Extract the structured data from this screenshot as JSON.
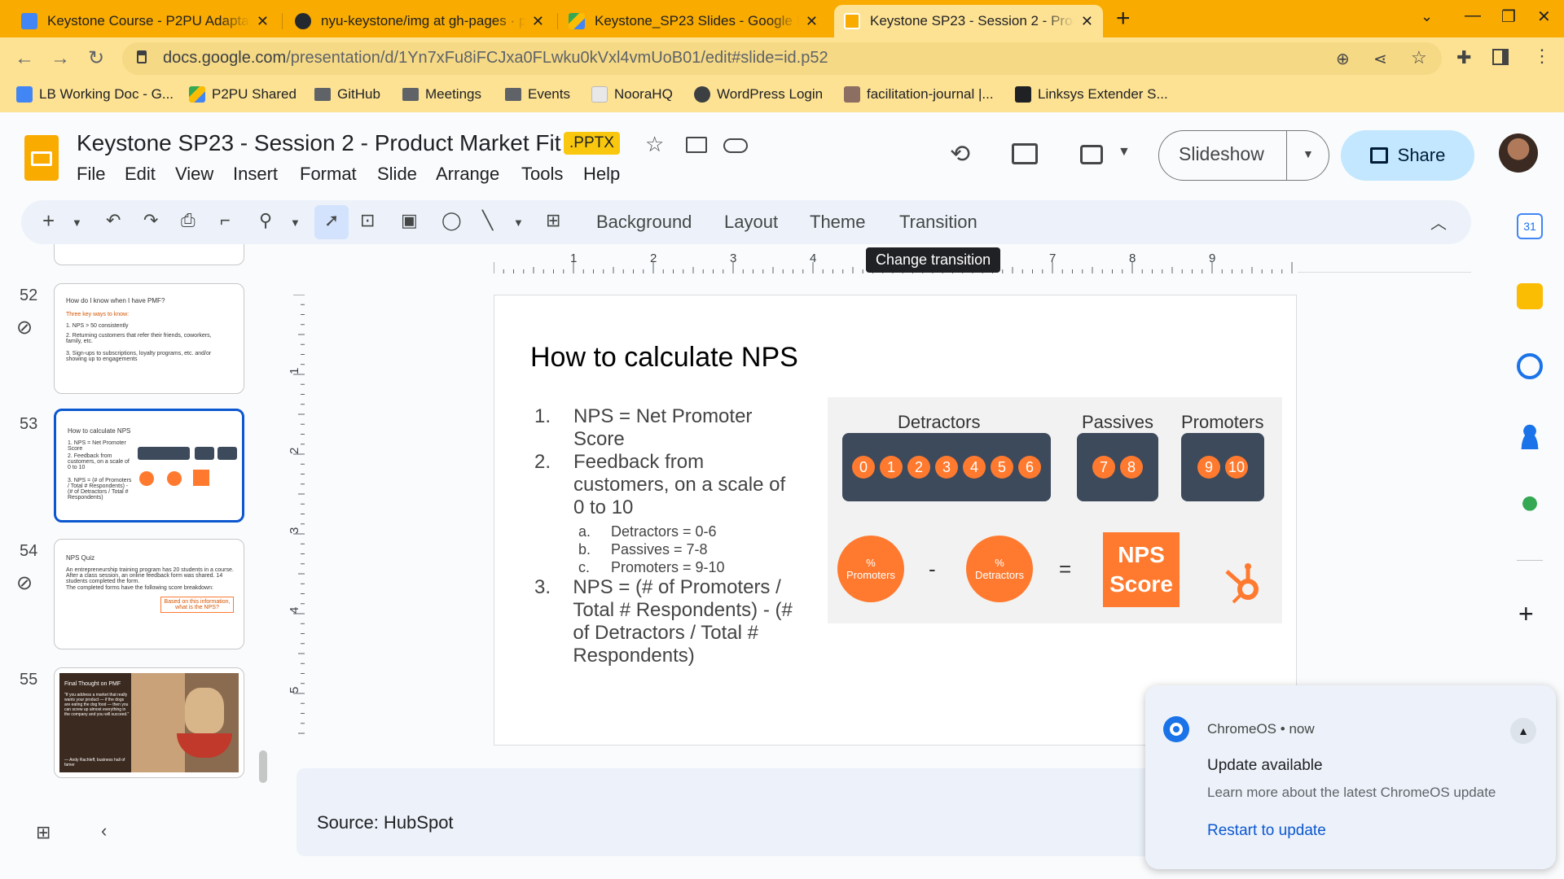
{
  "browser": {
    "tabs": [
      {
        "title": "Keystone Course - P2PU Adaptat",
        "color": "#4285f4"
      },
      {
        "title": "nyu-keystone/img at gh-pages · p",
        "color": "#24292f"
      },
      {
        "title": "Keystone_SP23 Slides - Google D",
        "color": "#34a853"
      },
      {
        "title": "Keystone SP23 - Session 2 - Prod",
        "color": "#f9ab00"
      }
    ],
    "new_tab": "+",
    "url_host": "docs.google.com",
    "url_path": "/presentation/d/1Yn7xFu8iFCJxa0FLwku0kVxl4vmUoB01/edit#slide=id.p52",
    "bookmarks": [
      "LB Working Doc - G...",
      "P2PU Shared",
      "GitHub",
      "Meetings",
      "Events",
      "NooraHQ",
      "WordPress Login",
      "facilitation-journal |...",
      "Linksys Extender S..."
    ]
  },
  "app": {
    "title": "Keystone SP23 - Session 2 - Product Market Fit",
    "badge": ".PPTX",
    "menu": [
      "File",
      "Edit",
      "View",
      "Insert",
      "Format",
      "Slide",
      "Arrange",
      "Tools",
      "Help"
    ],
    "slideshow_label": "Slideshow",
    "share_label": "Share"
  },
  "toolbar": {
    "background": "Background",
    "layout": "Layout",
    "theme": "Theme",
    "transition": "Transition",
    "tooltip": "Change transition"
  },
  "ruler": {
    "h_ticks": [
      "1",
      "2",
      "3",
      "4",
      "5",
      "6",
      "7",
      "8",
      "9"
    ],
    "v_ticks": [
      "1",
      "2",
      "3",
      "4",
      "5"
    ]
  },
  "filmstrip": [
    {
      "num": "52",
      "title": "How do I know when I have PMF?",
      "lines": [
        "Three key ways to know:",
        "1. NPS > 50 consistently",
        "2. Returning customers that refer their friends, coworkers, family, etc.",
        "3. Sign-ups to subscriptions, loyalty programs, etc. and/or showing up to engagements"
      ]
    },
    {
      "num": "53",
      "title": "How to calculate NPS",
      "lines": [
        "1. NPS = Net Promoter Score",
        "2. Feedback from customers, on a scale of 0 to 10",
        "3. NPS = (# of Promoters / Total # Respondents) - (# of Detractors / Total # Respondents)"
      ]
    },
    {
      "num": "54",
      "title": "NPS Quiz",
      "lines": [
        "An entrepreneurship training program has 20 students in a course. After a class session, an online feedback form was shared. 14 students completed the form.",
        "The completed forms have the following score breakdown:",
        "Based on this information, what is the NPS?"
      ]
    },
    {
      "num": "55",
      "title": "Final Thought on PMF",
      "lines": [
        "\"If you address a market that really wants your product — if the dogs are eating the dog food — then you can screw up almost everything in the company and you will succeed.\"",
        "— Andy Rachleff, business hall of famer"
      ]
    }
  ],
  "slide": {
    "title": "How to calculate NPS",
    "items": [
      {
        "num": "1.",
        "text": "NPS = Net Promoter Score"
      },
      {
        "num": "2.",
        "text": "Feedback from customers, on a scale of 0 to 10"
      },
      {
        "num": "3.",
        "text": "NPS = (# of Promoters / Total # Respondents) - (# of Detractors / Total # Respondents)"
      }
    ],
    "subitems": [
      {
        "num": "a.",
        "text": "Detractors = 0-6"
      },
      {
        "num": "b.",
        "text": "Passives = 7-8"
      },
      {
        "num": "c.",
        "text": "Promoters = 9-10"
      }
    ],
    "graphic": {
      "detractors_label": "Detractors",
      "passives_label": "Passives",
      "promoters_label": "Promoters",
      "detractor_scores": [
        "0",
        "1",
        "2",
        "3",
        "4",
        "5",
        "6"
      ],
      "passive_scores": [
        "7",
        "8"
      ],
      "promoter_scores": [
        "9",
        "10"
      ],
      "circle1": {
        "top": "%",
        "bottom": "Promoters"
      },
      "minus": "-",
      "circle2": {
        "top": "%",
        "bottom": "Detractors"
      },
      "equals": "=",
      "nps_line1": "NPS",
      "nps_line2": "Score",
      "orange": "#ff7a2f",
      "dark": "#3d4a5c"
    }
  },
  "notes": "Source: HubSpot",
  "notification": {
    "source": "ChromeOS",
    "time": "now",
    "title": "Update available",
    "body": "Learn more about the latest ChromeOS update",
    "action": "Restart to update"
  }
}
